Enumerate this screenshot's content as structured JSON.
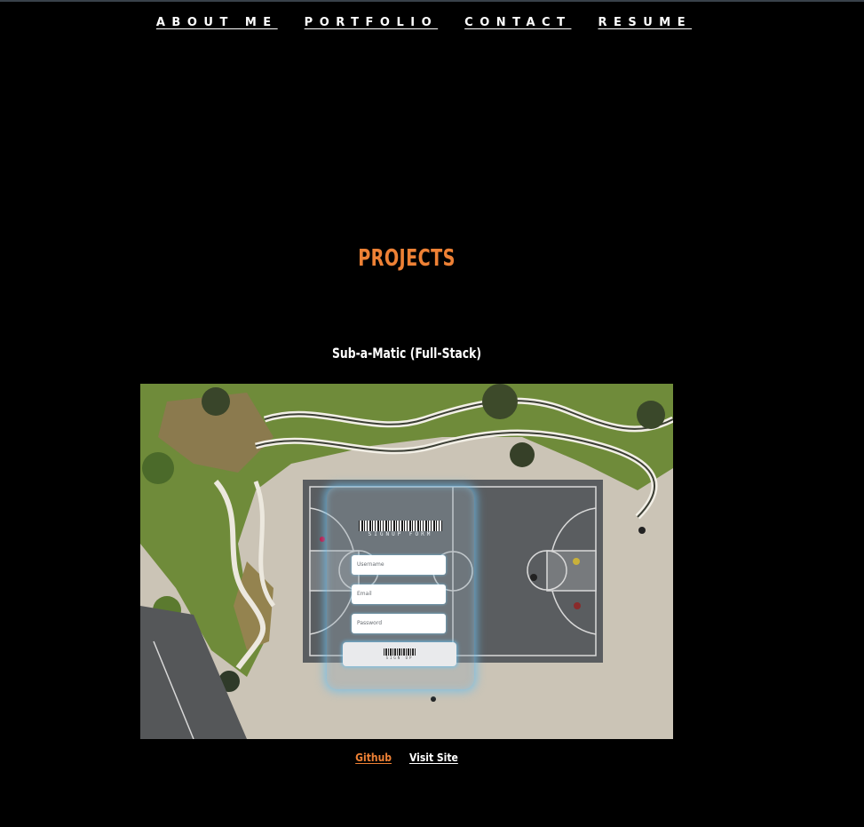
{
  "nav": {
    "items": [
      {
        "label": "ABOUT ME"
      },
      {
        "label": "PORTFOLIO"
      },
      {
        "label": "CONTACT"
      },
      {
        "label": "RESUME"
      }
    ]
  },
  "projects": {
    "title": "PROJECTS",
    "items": [
      {
        "name": "Sub-a-Matic (Full-Stack)",
        "screenshot": {
          "form_title": "SIGNUP FORM",
          "fields": [
            {
              "placeholder": "Username"
            },
            {
              "placeholder": "Email"
            },
            {
              "placeholder": "Password"
            }
          ],
          "button_label": "SIGN UP"
        },
        "links": {
          "github": "Github",
          "visit": "Visit Site"
        }
      }
    ]
  },
  "colors": {
    "accent": "#ee8135",
    "background": "#000000",
    "text": "#ffffff"
  }
}
